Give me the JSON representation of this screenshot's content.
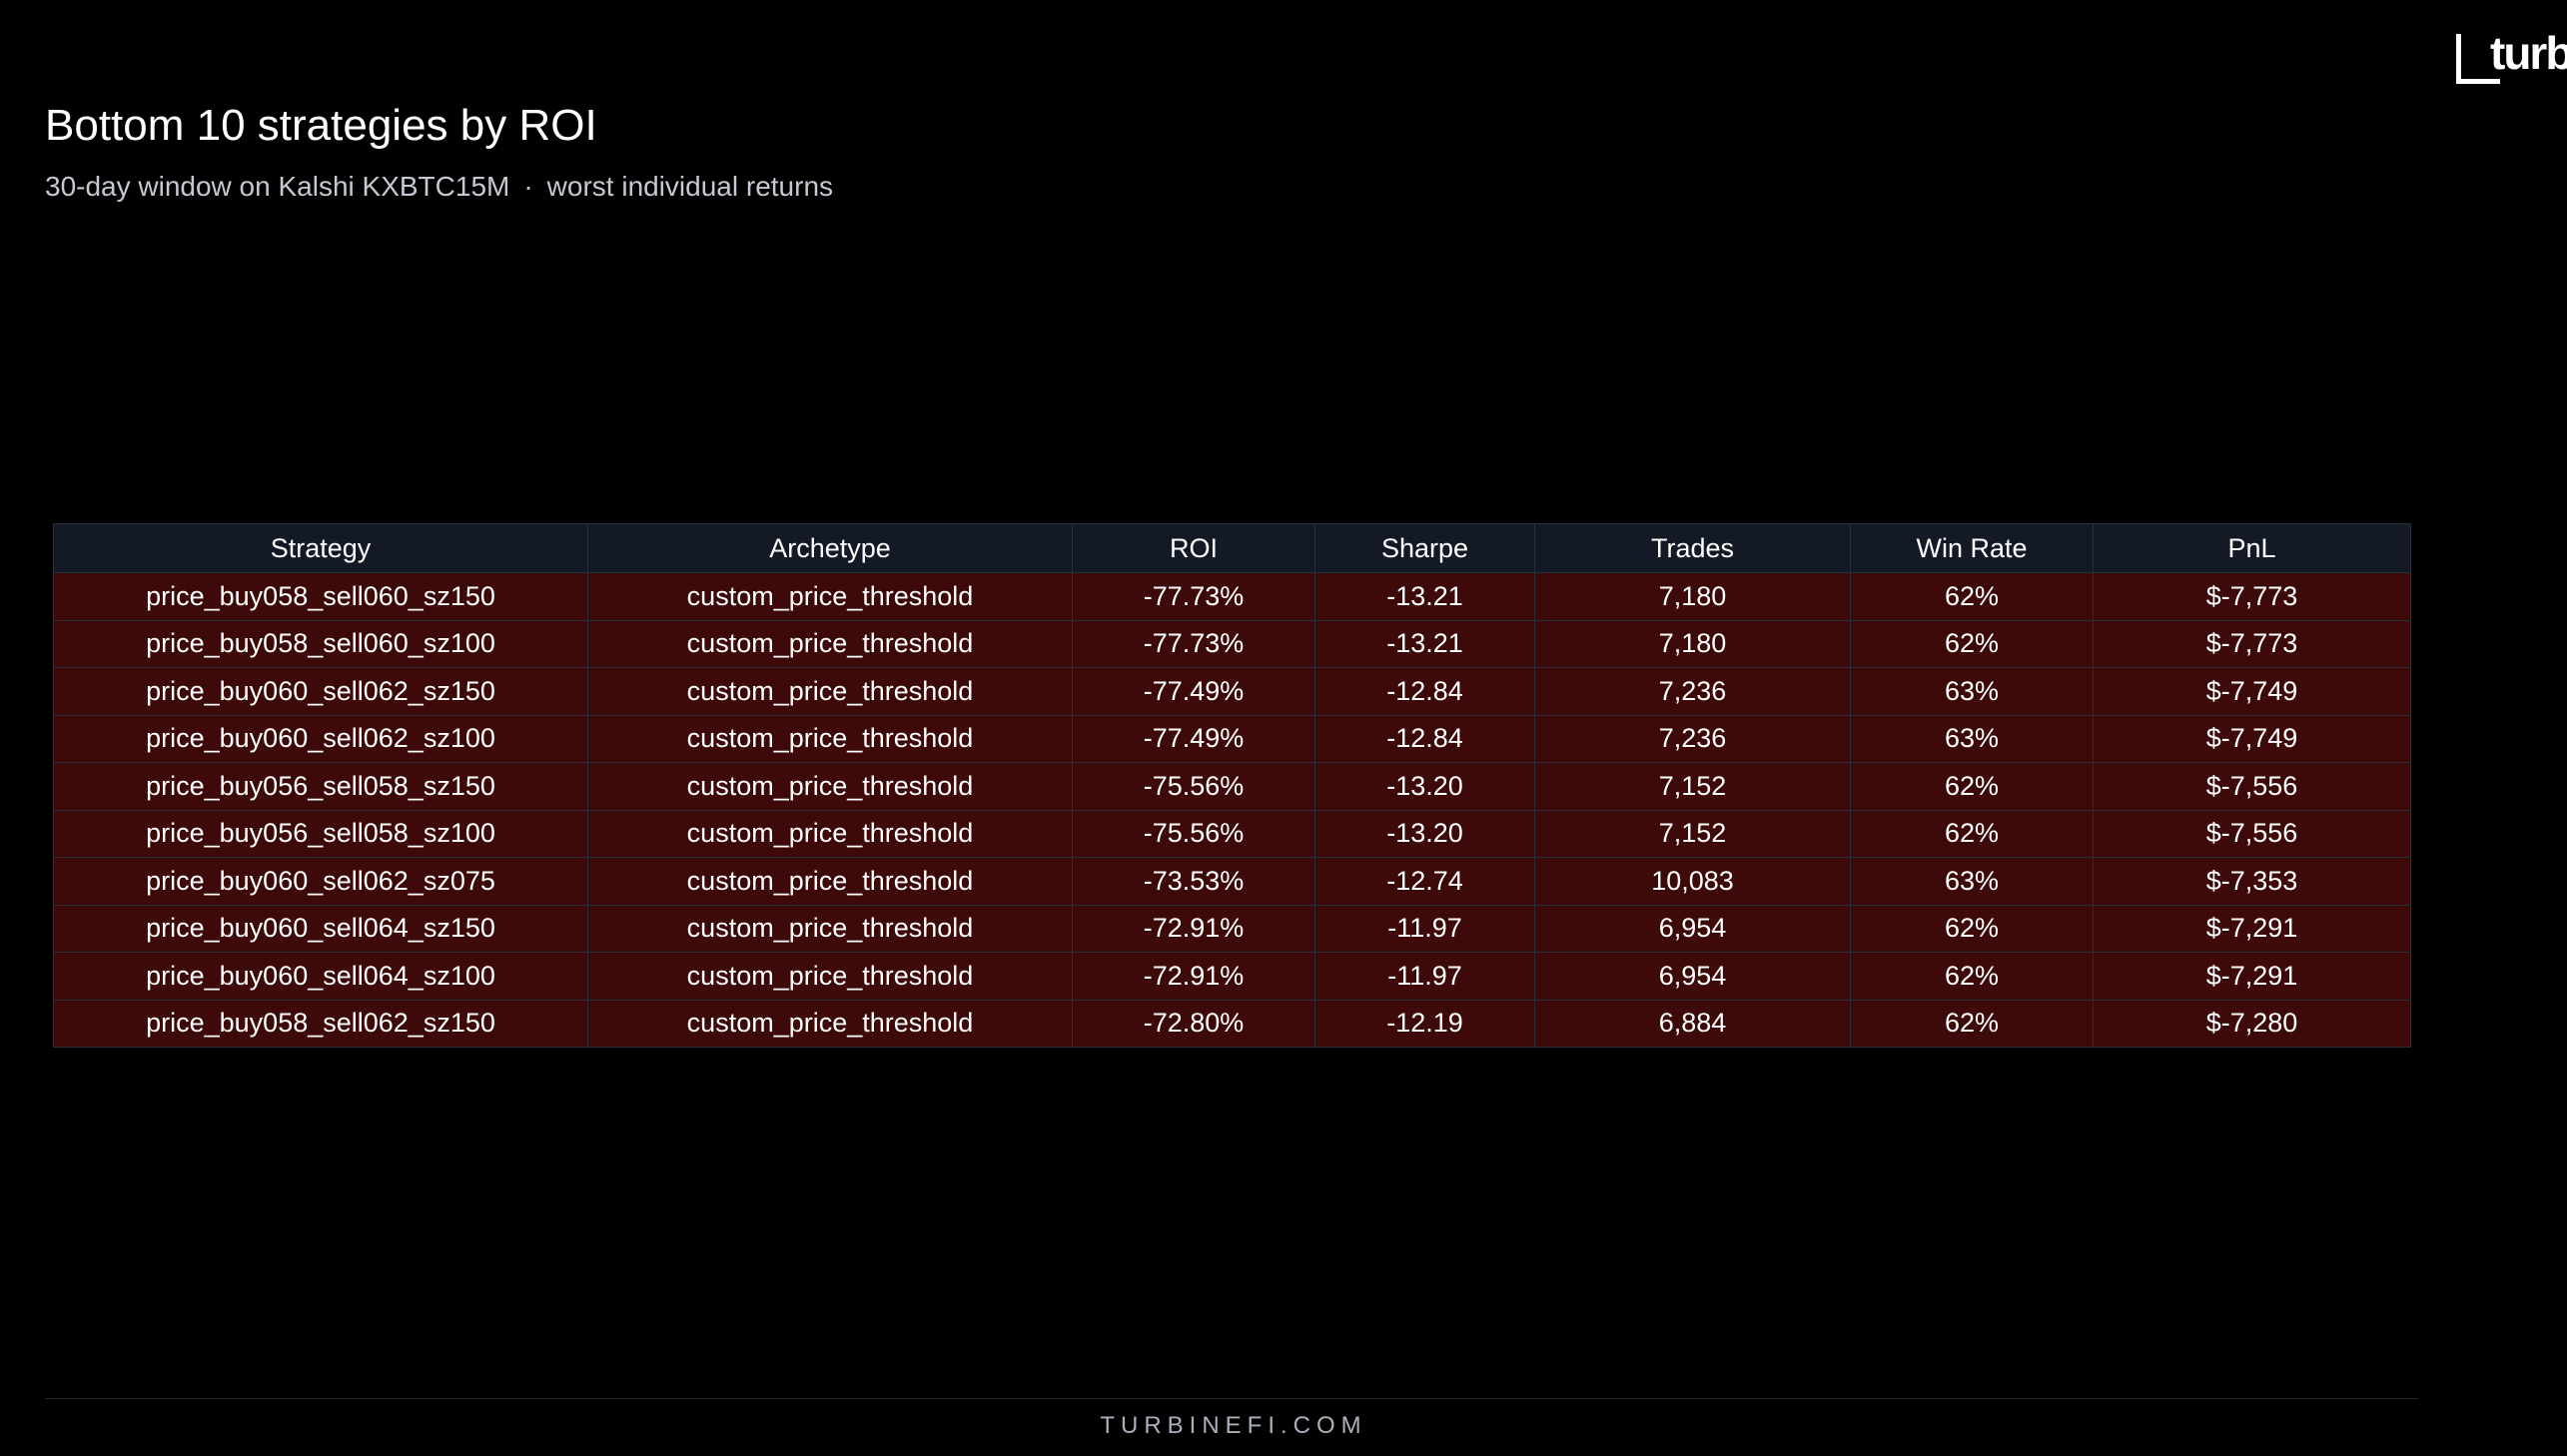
{
  "brand": {
    "logo_text": "turb",
    "footer": "TURBINEFI.COM"
  },
  "header": {
    "title": "Bottom 10 strategies by ROI",
    "subtitle_part1": "30-day window on Kalshi KXBTC15M",
    "subtitle_separator": "·",
    "subtitle_part2": "worst individual returns"
  },
  "colors": {
    "background": "#000000",
    "header_row": "#141a25",
    "negative_row": "#3d0909",
    "border": "#2a2f3d"
  },
  "chart_data": {
    "type": "table",
    "columns": [
      "Strategy",
      "Archetype",
      "ROI",
      "Sharpe",
      "Trades",
      "Win Rate",
      "PnL"
    ],
    "rows": [
      [
        "price_buy058_sell060_sz150",
        "custom_price_threshold",
        "-77.73%",
        "-13.21",
        "7,180",
        "62%",
        "$-7,773"
      ],
      [
        "price_buy058_sell060_sz100",
        "custom_price_threshold",
        "-77.73%",
        "-13.21",
        "7,180",
        "62%",
        "$-7,773"
      ],
      [
        "price_buy060_sell062_sz150",
        "custom_price_threshold",
        "-77.49%",
        "-12.84",
        "7,236",
        "63%",
        "$-7,749"
      ],
      [
        "price_buy060_sell062_sz100",
        "custom_price_threshold",
        "-77.49%",
        "-12.84",
        "7,236",
        "63%",
        "$-7,749"
      ],
      [
        "price_buy056_sell058_sz150",
        "custom_price_threshold",
        "-75.56%",
        "-13.20",
        "7,152",
        "62%",
        "$-7,556"
      ],
      [
        "price_buy056_sell058_sz100",
        "custom_price_threshold",
        "-75.56%",
        "-13.20",
        "7,152",
        "62%",
        "$-7,556"
      ],
      [
        "price_buy060_sell062_sz075",
        "custom_price_threshold",
        "-73.53%",
        "-12.74",
        "10,083",
        "63%",
        "$-7,353"
      ],
      [
        "price_buy060_sell064_sz150",
        "custom_price_threshold",
        "-72.91%",
        "-11.97",
        "6,954",
        "62%",
        "$-7,291"
      ],
      [
        "price_buy060_sell064_sz100",
        "custom_price_threshold",
        "-72.91%",
        "-11.97",
        "6,954",
        "62%",
        "$-7,291"
      ],
      [
        "price_buy058_sell062_sz150",
        "custom_price_threshold",
        "-72.80%",
        "-12.19",
        "6,884",
        "62%",
        "$-7,280"
      ]
    ]
  }
}
